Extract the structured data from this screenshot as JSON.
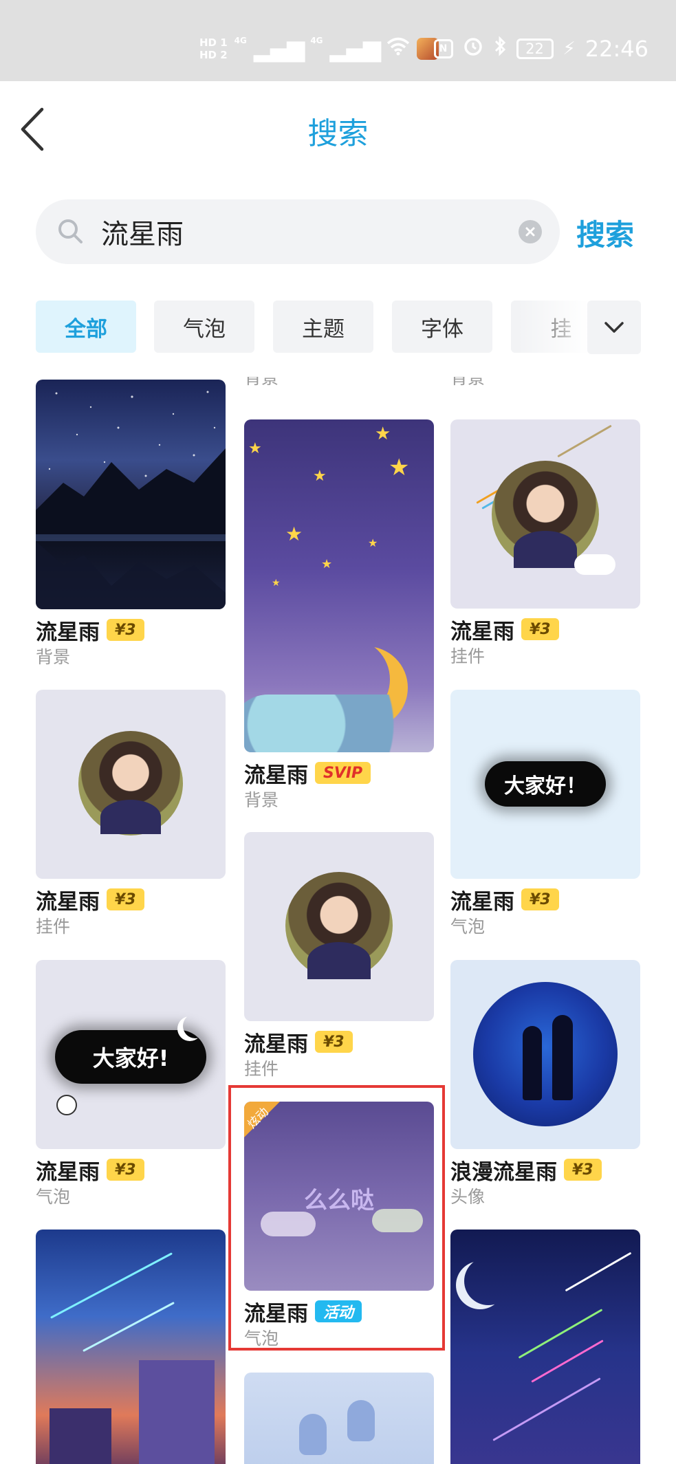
{
  "status_bar": {
    "sim1": "HD 1",
    "sim2": "HD 2",
    "net1": "4G",
    "net2": "4G",
    "battery": "22",
    "time": "22:46"
  },
  "header": {
    "title": "搜索",
    "back_icon": "chevron-left-icon"
  },
  "search": {
    "value": "流星雨",
    "button_label": "搜索"
  },
  "tabs": [
    {
      "label": "全部",
      "active": true
    },
    {
      "label": "气泡",
      "active": false
    },
    {
      "label": "主题",
      "active": false
    },
    {
      "label": "字体",
      "active": false
    },
    {
      "label": "挂",
      "active": false
    }
  ],
  "colors": {
    "accent": "#1ea0dc",
    "price_badge": "#ffd54a",
    "event_badge": "#23b9f0",
    "highlight": "#e53935"
  },
  "columns": [
    {
      "cut_category": "",
      "items": [
        {
          "name": "流星雨",
          "badge": "¥3",
          "badge_type": "price",
          "category": "背景"
        },
        {
          "name": "流星雨",
          "badge": "¥3",
          "badge_type": "price",
          "category": "挂件"
        },
        {
          "name": "流星雨",
          "badge": "¥3",
          "badge_type": "price",
          "category": "气泡"
        },
        {
          "name": "",
          "badge": "",
          "badge_type": "",
          "category": ""
        }
      ]
    },
    {
      "cut_category": "背景",
      "items": [
        {
          "name": "流星雨",
          "badge": "SVIP",
          "badge_type": "svip",
          "category": "背景"
        },
        {
          "name": "流星雨",
          "badge": "¥3",
          "badge_type": "price",
          "category": "挂件"
        },
        {
          "name": "流星雨",
          "badge": "活动",
          "badge_type": "event",
          "category": "气泡",
          "ribbon": "炫动",
          "overlay": "么么哒"
        },
        {
          "name": "",
          "badge": "",
          "badge_type": "",
          "category": ""
        }
      ]
    },
    {
      "cut_category": "背景",
      "items": [
        {
          "name": "流星雨",
          "badge": "¥3",
          "badge_type": "price",
          "category": "挂件"
        },
        {
          "name": "流星雨",
          "badge": "¥3",
          "badge_type": "price",
          "category": "气泡",
          "overlay": "大家好！"
        },
        {
          "name": "浪漫流星雨",
          "badge": "¥3",
          "badge_type": "price",
          "category": "头像"
        },
        {
          "name": "",
          "badge": "",
          "badge_type": "",
          "category": ""
        }
      ]
    }
  ],
  "bubble_text_left": "大家好!"
}
